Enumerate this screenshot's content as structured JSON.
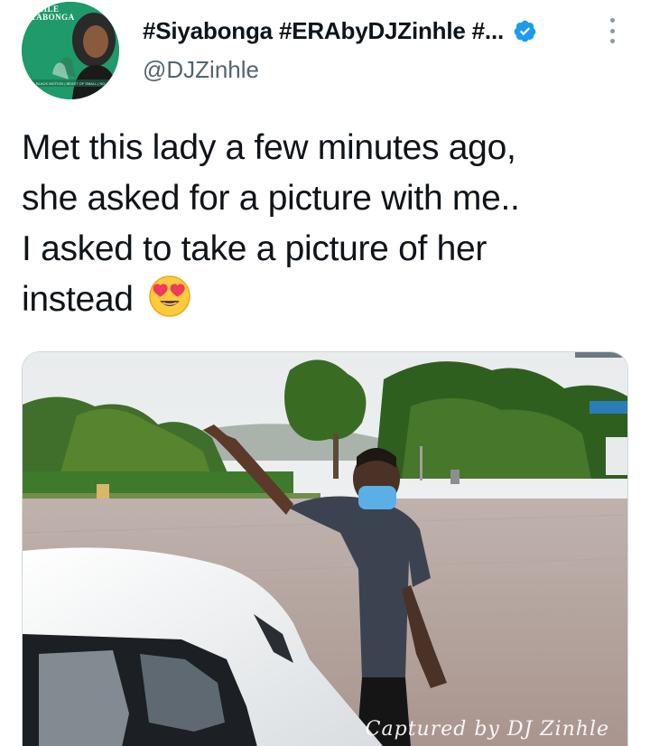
{
  "profile": {
    "avatar_brand_line1": "INHLE",
    "avatar_brand_line2": "YABONGA",
    "avatar_ribbon": "BLACK MOTION | BEAST OF SMALL | NO",
    "avatar_bg": "#1f9a6a",
    "display_name": "#Siyabonga #ERAbyDJZinhle #...",
    "handle": "@DJZinhle",
    "verified_color": "#1d9bf0"
  },
  "tweet": {
    "text_line1": "Met this lady a few minutes ago,",
    "text_line2": "she asked for a picture with me..",
    "text_line3": "I asked to take a picture of her",
    "text_line4": "instead",
    "emoji": "heart-eyes-emoji"
  },
  "media": {
    "watermark": "Captured by DJ Zinhle"
  }
}
